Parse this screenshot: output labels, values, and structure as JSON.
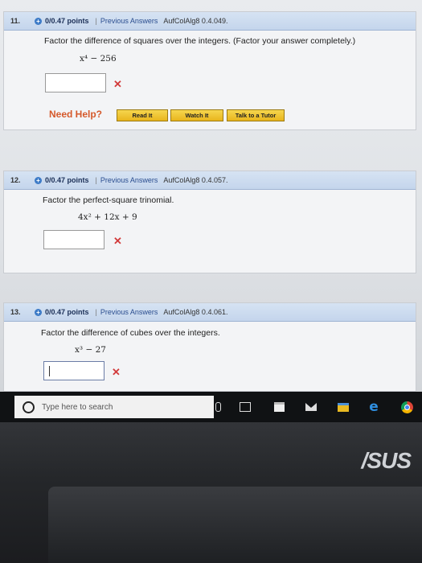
{
  "questions": [
    {
      "number": "11.",
      "points": "0/0.47 points",
      "separator": "|",
      "previous_answers": "Previous Answers",
      "code": "AufColAlg8 0.4.049.",
      "prompt": "Factor the difference of squares over the integers. (Factor your answer completely.)",
      "expression": "x⁴ − 256",
      "answer_value": "",
      "status": "✕",
      "need_help": "Need Help?",
      "help_buttons": [
        "Read It",
        "Watch It",
        "Talk to a Tutor"
      ]
    },
    {
      "number": "12.",
      "points": "0/0.47 points",
      "separator": "|",
      "previous_answers": "Previous Answers",
      "code": "AufColAlg8 0.4.057.",
      "prompt": "Factor the perfect-square trinomial.",
      "expression": "4x² + 12x + 9",
      "answer_value": "",
      "status": "✕"
    },
    {
      "number": "13.",
      "points": "0/0.47 points",
      "separator": "|",
      "previous_answers": "Previous Answers",
      "code": "AufColAlg8 0.4.061.",
      "prompt": "Factor the difference of cubes over the integers.",
      "expression": "x³ − 27",
      "answer_value": "",
      "status": "✕"
    }
  ],
  "taskbar": {
    "search_placeholder": "Type here to search"
  },
  "brand": "/SUS",
  "colors": {
    "wrong": "#d23a3a",
    "help_text": "#d5592b",
    "help_button": "#e9b51c",
    "header": "#c4d5ec"
  }
}
